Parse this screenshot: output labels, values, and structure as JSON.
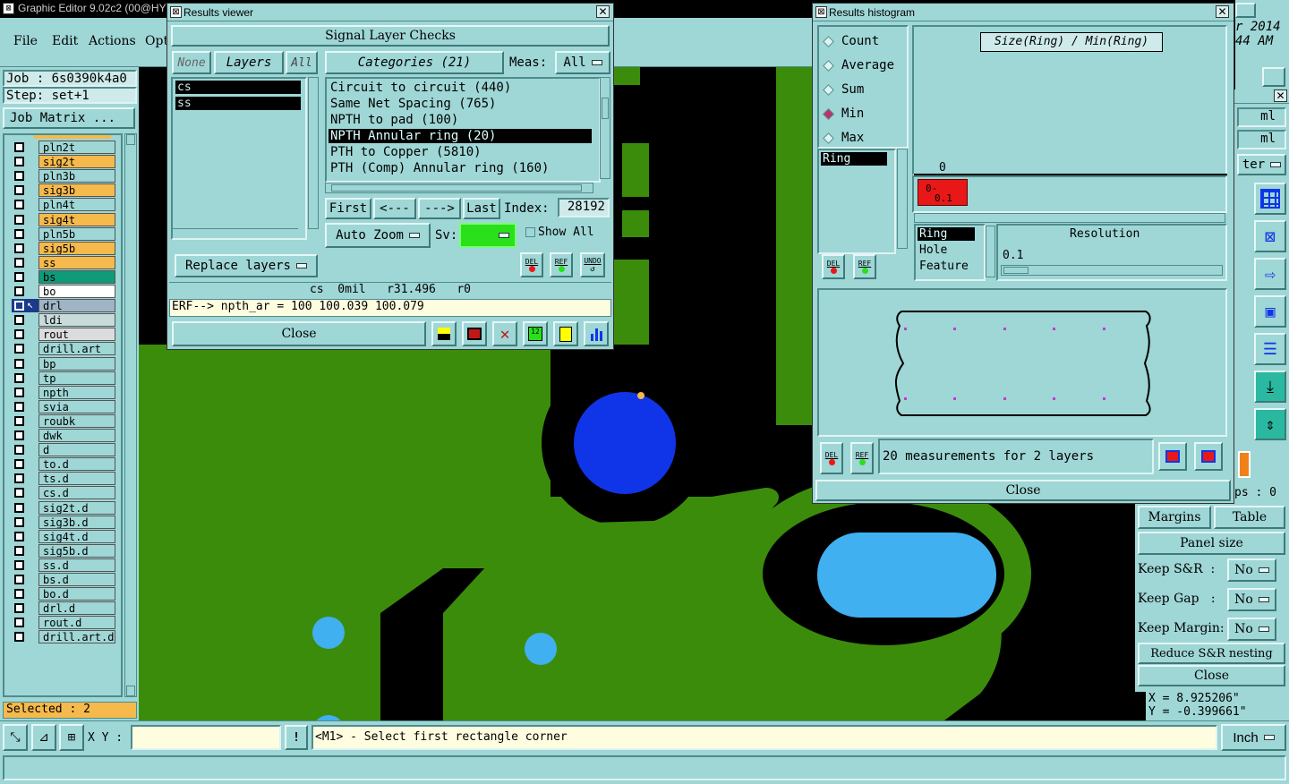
{
  "main": {
    "title": "Graphic Editor 9.02c2 (00@HY",
    "menu": [
      "File",
      "Edit",
      "Actions",
      "Opt"
    ],
    "date_partial_1": "r 2014",
    "date_partial_2": "44 AM",
    "job": "Job : 6s0390k4a0",
    "step": "Step: set+1",
    "job_matrix": "Job Matrix ...",
    "selected": "Selected : 2"
  },
  "layers": [
    {
      "name": "pln2t",
      "color": "#9fd6d6",
      "active": false
    },
    {
      "name": "sig2t",
      "color": "#f5b94c",
      "active": false
    },
    {
      "name": "pln3b",
      "color": "#9fd6d6",
      "active": false
    },
    {
      "name": "sig3b",
      "color": "#f5b94c",
      "active": false
    },
    {
      "name": "pln4t",
      "color": "#9fd6d6",
      "active": false
    },
    {
      "name": "sig4t",
      "color": "#f5b94c",
      "active": false
    },
    {
      "name": "pln5b",
      "color": "#9fd6d6",
      "active": false
    },
    {
      "name": "sig5b",
      "color": "#f5b94c",
      "active": false
    },
    {
      "name": "ss",
      "color": "#f5b94c",
      "active": false
    },
    {
      "name": "bs",
      "color": "#0f9a7a",
      "active": false
    },
    {
      "name": "bo",
      "color": "#ffffff",
      "active": false
    },
    {
      "name": "drl",
      "color": "#9fb4c4",
      "active": true
    },
    {
      "name": "ldi",
      "color": "#c8dada",
      "active": false
    },
    {
      "name": "rout",
      "color": "#dcdcdc",
      "active": false
    },
    {
      "name": "drill.art",
      "color": "#9fd6d6",
      "active": false
    },
    {
      "name": "bp",
      "color": "#9fd6d6",
      "active": false
    },
    {
      "name": "tp",
      "color": "#9fd6d6",
      "active": false
    },
    {
      "name": "npth",
      "color": "#9fd6d6",
      "active": false
    },
    {
      "name": "svia",
      "color": "#9fd6d6",
      "active": false
    },
    {
      "name": "roubk",
      "color": "#9fd6d6",
      "active": false
    },
    {
      "name": "dwk",
      "color": "#9fd6d6",
      "active": false
    },
    {
      "name": "d",
      "color": "#9fd6d6",
      "active": false
    },
    {
      "name": "to.d",
      "color": "#9fd6d6",
      "active": false
    },
    {
      "name": "ts.d",
      "color": "#9fd6d6",
      "active": false
    },
    {
      "name": "cs.d",
      "color": "#9fd6d6",
      "active": false
    },
    {
      "name": "sig2t.d",
      "color": "#9fd6d6",
      "active": false
    },
    {
      "name": "sig3b.d",
      "color": "#9fd6d6",
      "active": false
    },
    {
      "name": "sig4t.d",
      "color": "#9fd6d6",
      "active": false
    },
    {
      "name": "sig5b.d",
      "color": "#9fd6d6",
      "active": false
    },
    {
      "name": "ss.d",
      "color": "#9fd6d6",
      "active": false
    },
    {
      "name": "bs.d",
      "color": "#9fd6d6",
      "active": false
    },
    {
      "name": "bo.d",
      "color": "#9fd6d6",
      "active": false
    },
    {
      "name": "drl.d",
      "color": "#9fd6d6",
      "active": false
    },
    {
      "name": "rout.d",
      "color": "#9fd6d6",
      "active": false
    },
    {
      "name": "drill.art.d",
      "color": "#9fd6d6",
      "active": false
    }
  ],
  "results_viewer": {
    "title": "Results viewer",
    "header": "Signal Layer Checks",
    "btn_none": "None",
    "btn_layers": "Layers",
    "btn_all": "All",
    "categories_label": "Categories (21)",
    "meas_label": "Meas:",
    "meas_value": "All",
    "layer_list": [
      "cs",
      "ss"
    ],
    "category_list": [
      "Circuit to circuit (440)",
      "Same Net Spacing (765)",
      "NPTH to pad (100)",
      "NPTH Annular ring (20)",
      "PTH to Copper (5810)",
      "PTH (Comp) Annular ring (160)"
    ],
    "selected_category_index": 3,
    "btn_first": "First",
    "btn_prev": "<---",
    "btn_next": "--->",
    "btn_last": "Last",
    "index_label": "Index:",
    "index_value": "28192",
    "auto_zoom": "Auto Zoom",
    "sv_label": "Sv:",
    "show_all": "Show All",
    "replace_layers": "Replace layers",
    "btn_del": "DEL",
    "btn_ref": "REF",
    "btn_undo": "UNDO",
    "status_line": "cs  0mil   r31.496   r0",
    "erf_line": "ERF--> npth_ar = 100 100.039 100.079",
    "close": "Close"
  },
  "histogram": {
    "title": "Results histogram",
    "radio": [
      "Count",
      "Average",
      "Sum",
      "Min",
      "Max"
    ],
    "radio_selected": "Min",
    "chart_title": "Size(Ring) / Min(Ring)",
    "axis_zero": "0",
    "bar_label_1": "0-",
    "bar_label_2": "0.1",
    "list_top": [
      "Ring"
    ],
    "list_bottom": [
      "Ring",
      "Hole",
      "Feature"
    ],
    "resolution_label": "Resolution",
    "resolution_value": "0.1",
    "btn_del": "DEL",
    "btn_ref": "REF",
    "summary": "20 measurements for 2 layers",
    "close": "Close"
  },
  "right_panel": {
    "ml_1": "ml",
    "ml_2": "ml",
    "iter": "ter",
    "ps": "ps : 0",
    "margins": "Margins",
    "table": "Table",
    "panel_size": "Panel size",
    "keep_sr_label": "Keep S&R  :",
    "keep_sr_value": "No",
    "keep_gap_label": "Keep Gap   :",
    "keep_gap_value": "No",
    "keep_margin_label": "Keep Margin:",
    "keep_margin_value": "No",
    "reduce": "Reduce S&R nesting",
    "close": "Close",
    "coord_x": "X = 8.925206\"",
    "coord_y": "Y = -0.399661\""
  },
  "bottom_bar": {
    "xy_label": "X Y :",
    "xy_value": "",
    "prompt": "<M1> - Select first rectangle corner",
    "units": "Inch"
  },
  "colors": {
    "panel_teal": "#9fd6d6",
    "board_green": "#3c8c0c",
    "hole_blue": "#1035e8",
    "hole_lightblue": "#40b0f0",
    "highlight_red": "#e81818",
    "signal_orange": "#f5b94c"
  }
}
